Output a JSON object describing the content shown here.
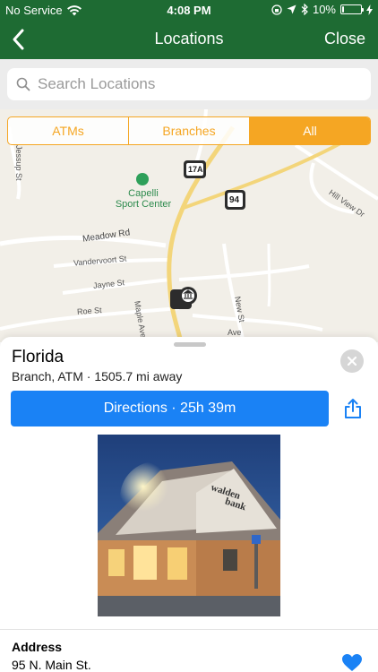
{
  "status_bar": {
    "carrier": "No Service",
    "time": "4:08 PM",
    "battery_label": "10%",
    "battery_level": 0.1
  },
  "nav": {
    "title": "Locations",
    "close_label": "Close"
  },
  "search": {
    "placeholder": "Search Locations"
  },
  "filters": {
    "items": [
      "ATMs",
      "Branches",
      "All"
    ],
    "selected": "All"
  },
  "map": {
    "poi": "Capelli\nSport Center",
    "route_shields": [
      "17A",
      "94"
    ],
    "streets": [
      "Meadow Rd",
      "Vandervoort St",
      "Jayne St",
      "Roe St",
      "Maple Ave",
      "New St",
      "Hill View Dr",
      "Jessup St",
      "Ave"
    ]
  },
  "location": {
    "name": "Florida",
    "meta": "Branch, ATM · 1505.7 mi away",
    "directions_label": "Directions · 25h 39m",
    "address_label": "Address",
    "address_value": "95 N. Main St.",
    "photo_sign_line1": "walden",
    "photo_sign_line2": "bank"
  },
  "colors": {
    "brand_green": "#1e6b33",
    "accent_orange": "#f5a623",
    "action_blue": "#1a82f5"
  },
  "icons": [
    "wifi-icon",
    "chevron-left-icon",
    "search-icon",
    "close-icon",
    "share-icon",
    "heart-icon",
    "bank-pin-icon"
  ]
}
